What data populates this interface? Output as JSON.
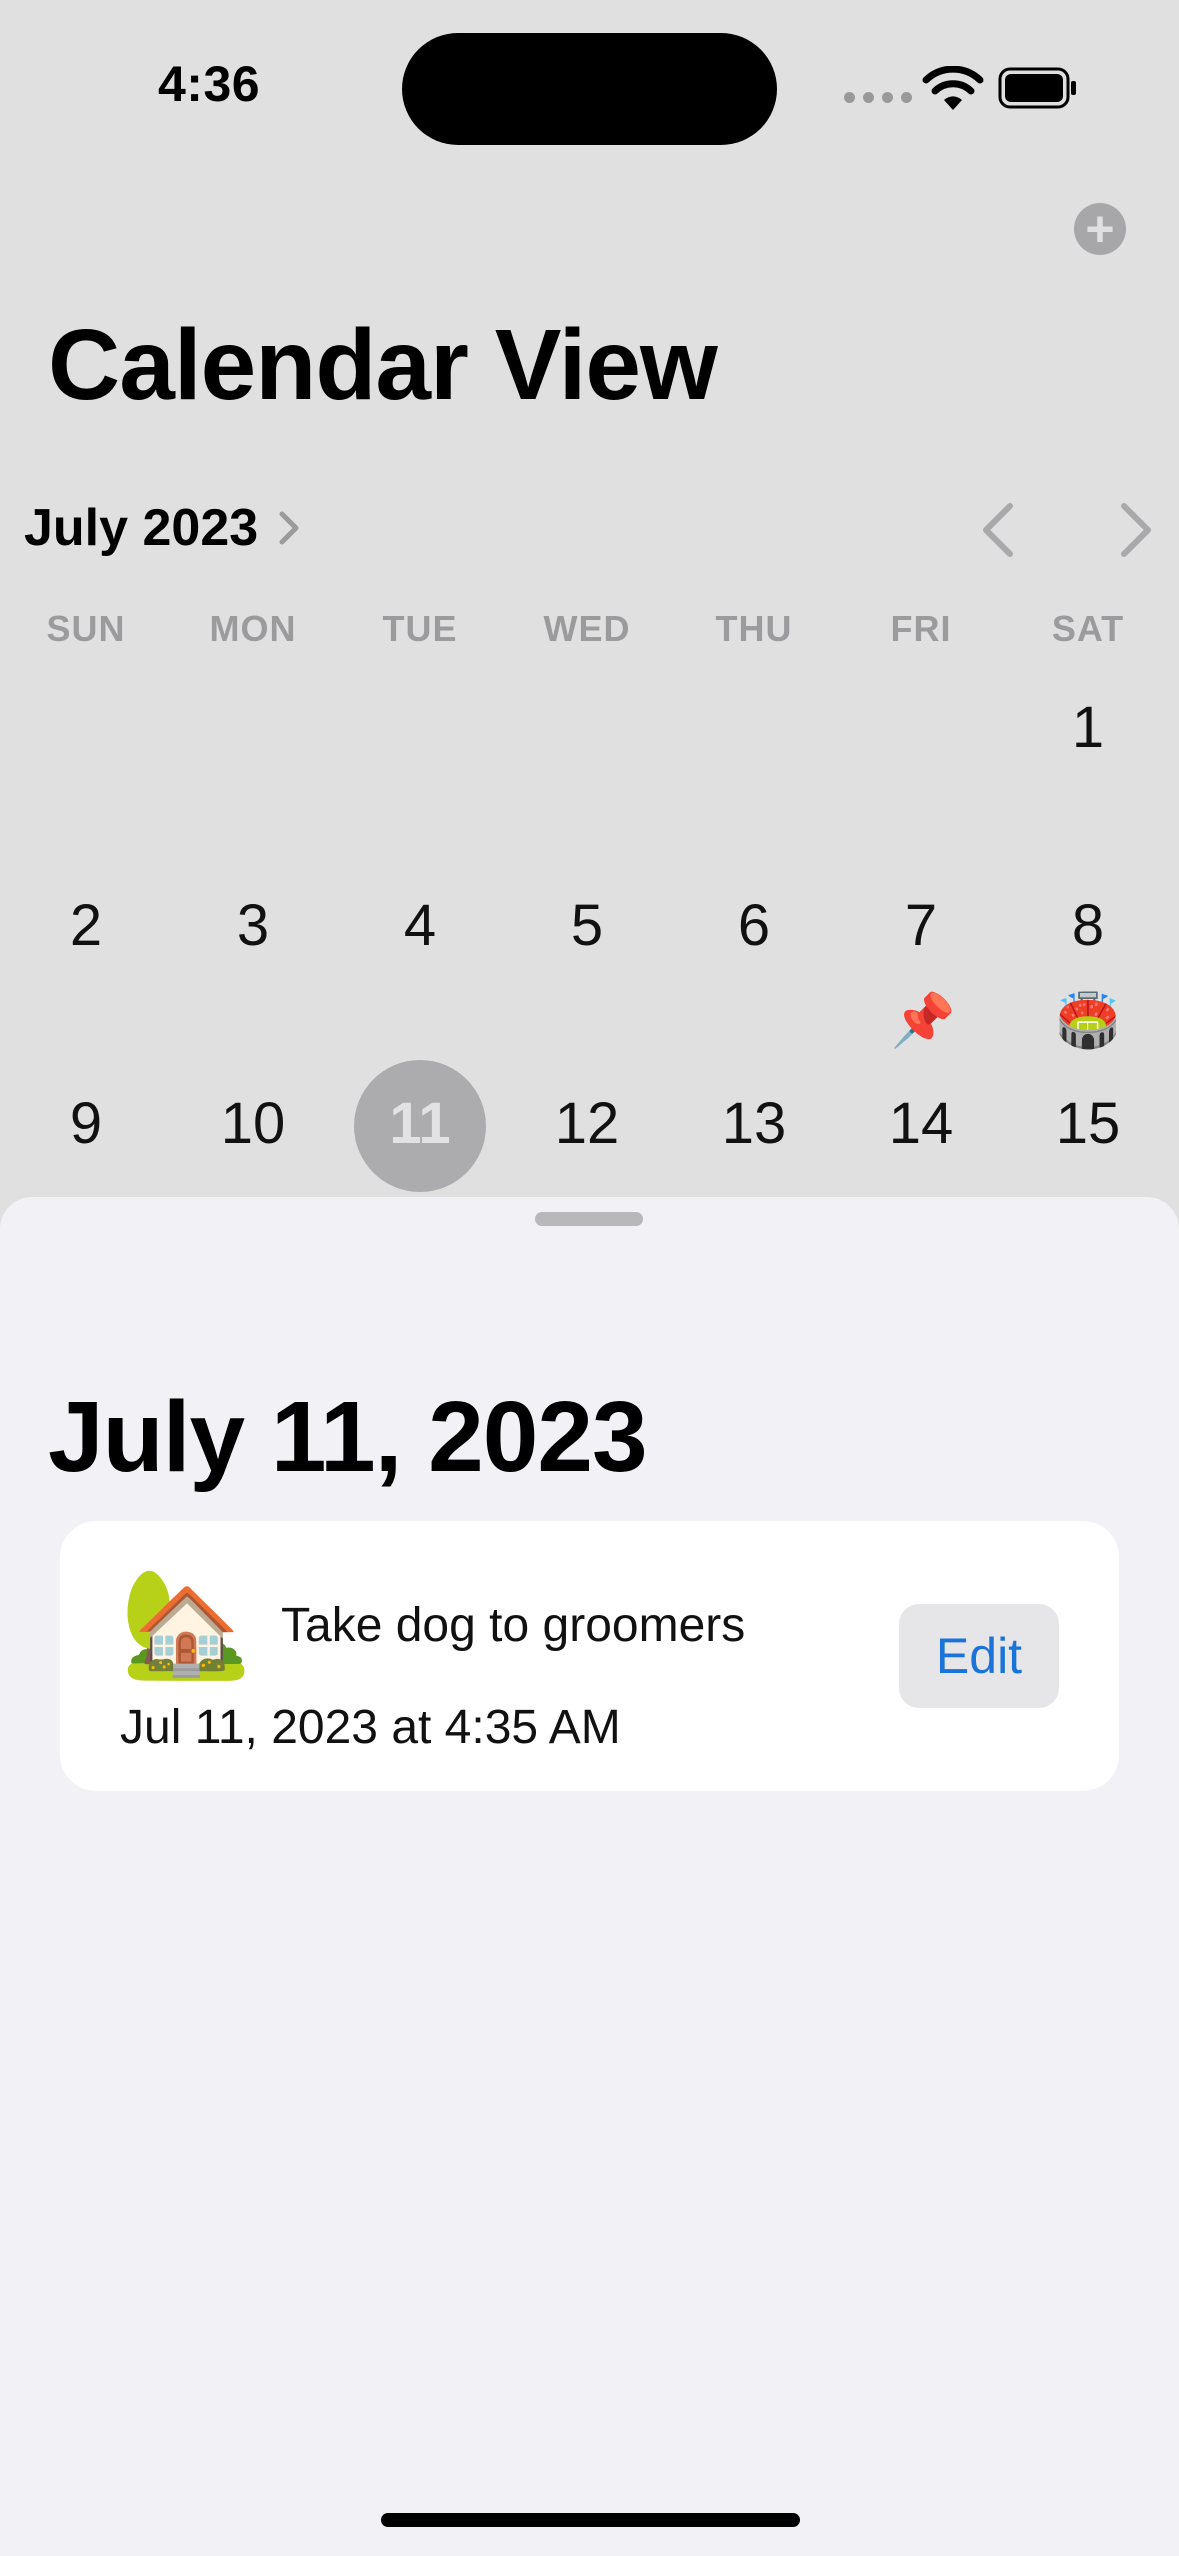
{
  "status_bar": {
    "time": "4:36"
  },
  "header": {
    "title": "Calendar View",
    "add_icon": "plus-circle-icon"
  },
  "calendar": {
    "month_label": "July 2023",
    "weekdays": [
      "SUN",
      "MON",
      "TUE",
      "WED",
      "THU",
      "FRI",
      "SAT"
    ],
    "days": [
      "1",
      "2",
      "3",
      "4",
      "5",
      "6",
      "7",
      "8",
      "9",
      "10",
      "11",
      "12",
      "13",
      "14",
      "15"
    ],
    "selected_day": "11",
    "event_markers": {
      "fri_14": "📌",
      "sat_15": "🏟️"
    }
  },
  "detail": {
    "date_title": "July 11, 2023",
    "event": {
      "emoji": "🏡",
      "title": "Take dog to groomers",
      "datetime": "Jul 11, 2023 at 4:35 AM",
      "edit_label": "Edit"
    }
  },
  "colors": {
    "accent": "#1a73d9",
    "selected_circle": "#acacae",
    "sheet_bg": "#f1f1f6"
  }
}
